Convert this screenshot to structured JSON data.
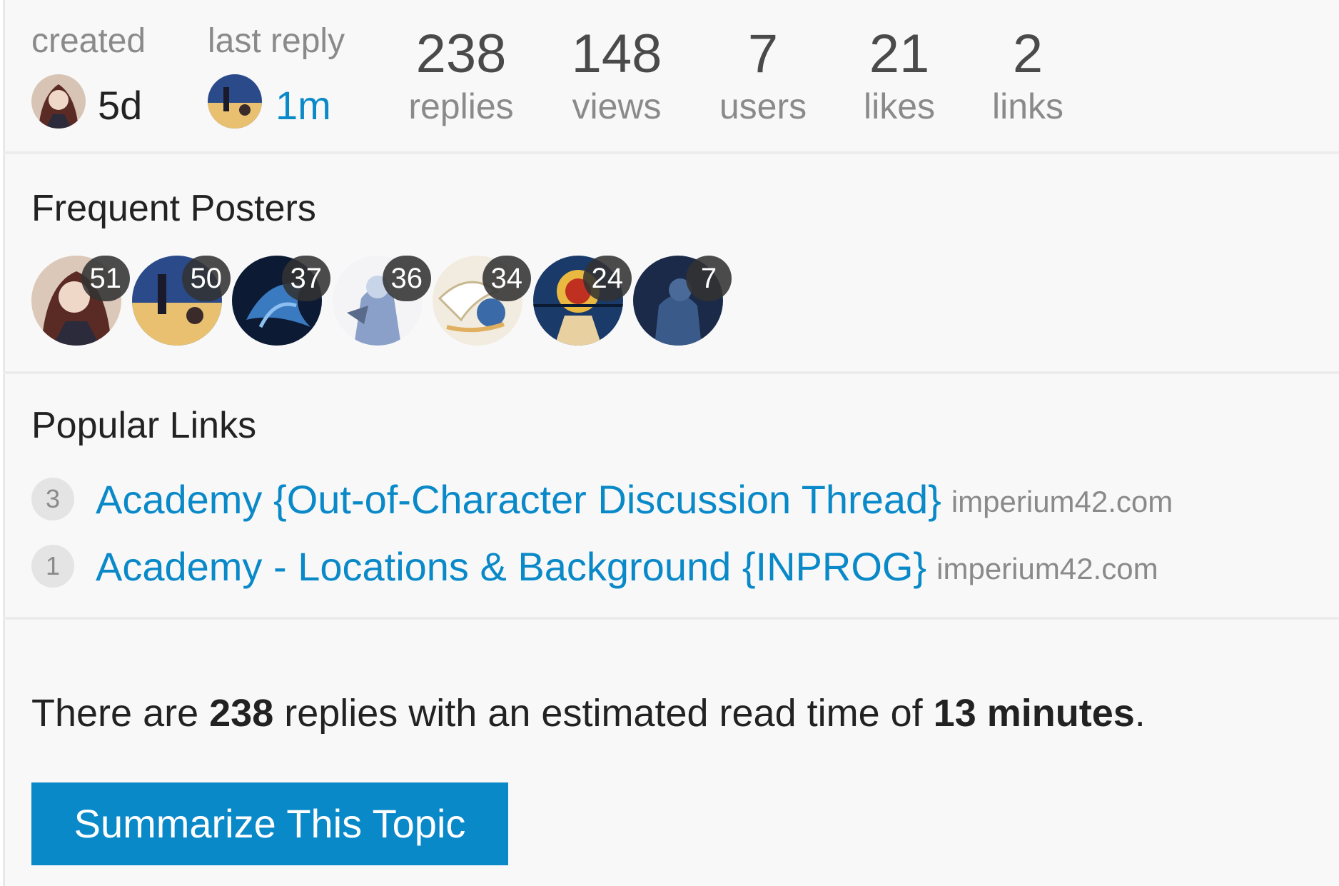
{
  "stats": {
    "created_label": "created",
    "created_value": "5d",
    "last_reply_label": "last reply",
    "last_reply_value": "1m",
    "metrics": [
      {
        "value": "238",
        "label": "replies"
      },
      {
        "value": "148",
        "label": "views"
      },
      {
        "value": "7",
        "label": "users"
      },
      {
        "value": "21",
        "label": "likes"
      },
      {
        "value": "2",
        "label": "links"
      }
    ]
  },
  "frequent_posters": {
    "title": "Frequent Posters",
    "counts": [
      "51",
      "50",
      "37",
      "36",
      "34",
      "24",
      "7"
    ]
  },
  "popular_links": {
    "title": "Popular Links",
    "items": [
      {
        "count": "3",
        "title": "Academy {Out-of-Character Discussion Thread}",
        "domain": "imperium42.com"
      },
      {
        "count": "1",
        "title": "Academy - Locations & Background {INPROG}",
        "domain": "imperium42.com"
      }
    ]
  },
  "summary": {
    "prefix": "There are ",
    "replies": "238",
    "middle": " replies with an estimated read time of ",
    "minutes": "13 minutes",
    "suffix": "."
  },
  "summarize_button": "Summarize This Topic",
  "colors": {
    "link_blue": "#0a89c9",
    "panel_bg": "#f8f8f8",
    "badge_bg": "#323232"
  }
}
